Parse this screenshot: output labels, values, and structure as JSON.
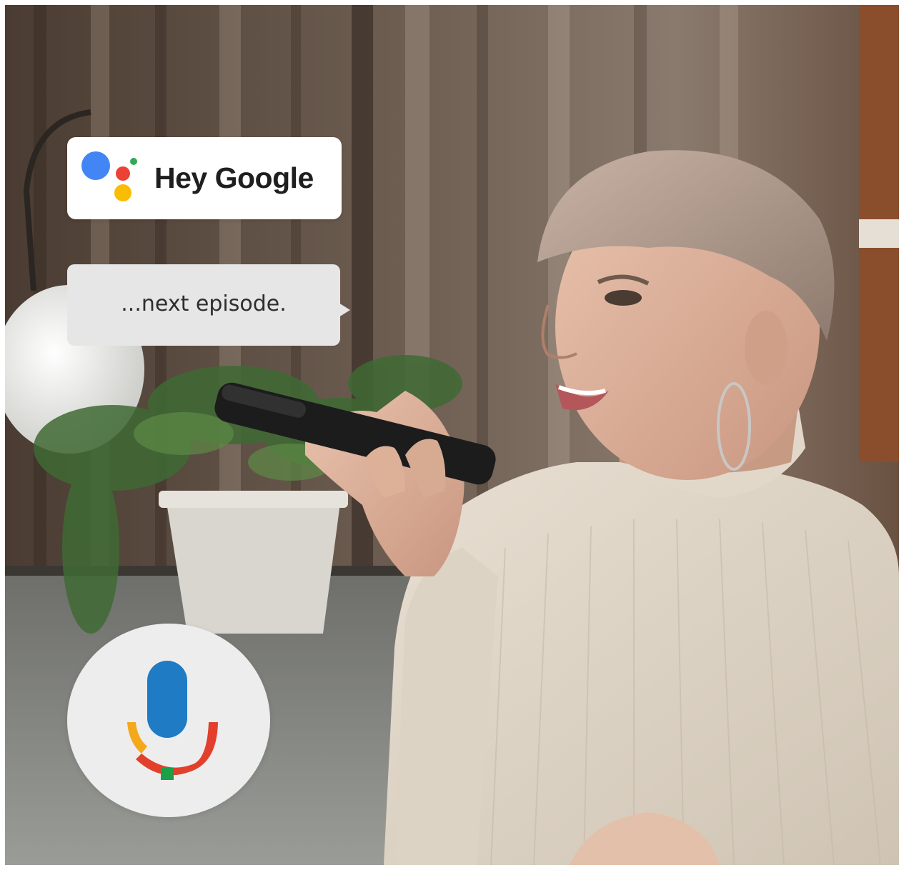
{
  "assistant_card": {
    "wake_phrase": "Hey Google",
    "logo_icon": "google-assistant-dots-icon"
  },
  "speech_bubble": {
    "text": "...next episode."
  },
  "mic_button": {
    "icon": "microphone-icon"
  },
  "colors": {
    "google_blue": "#4285F4",
    "google_red": "#EA4335",
    "google_yellow": "#FBBC05",
    "google_green": "#34A853",
    "mic_blue": "#1E7BC4",
    "mic_orange": "#F4A81C",
    "mic_red": "#E2402C",
    "mic_green": "#1D9E48"
  }
}
